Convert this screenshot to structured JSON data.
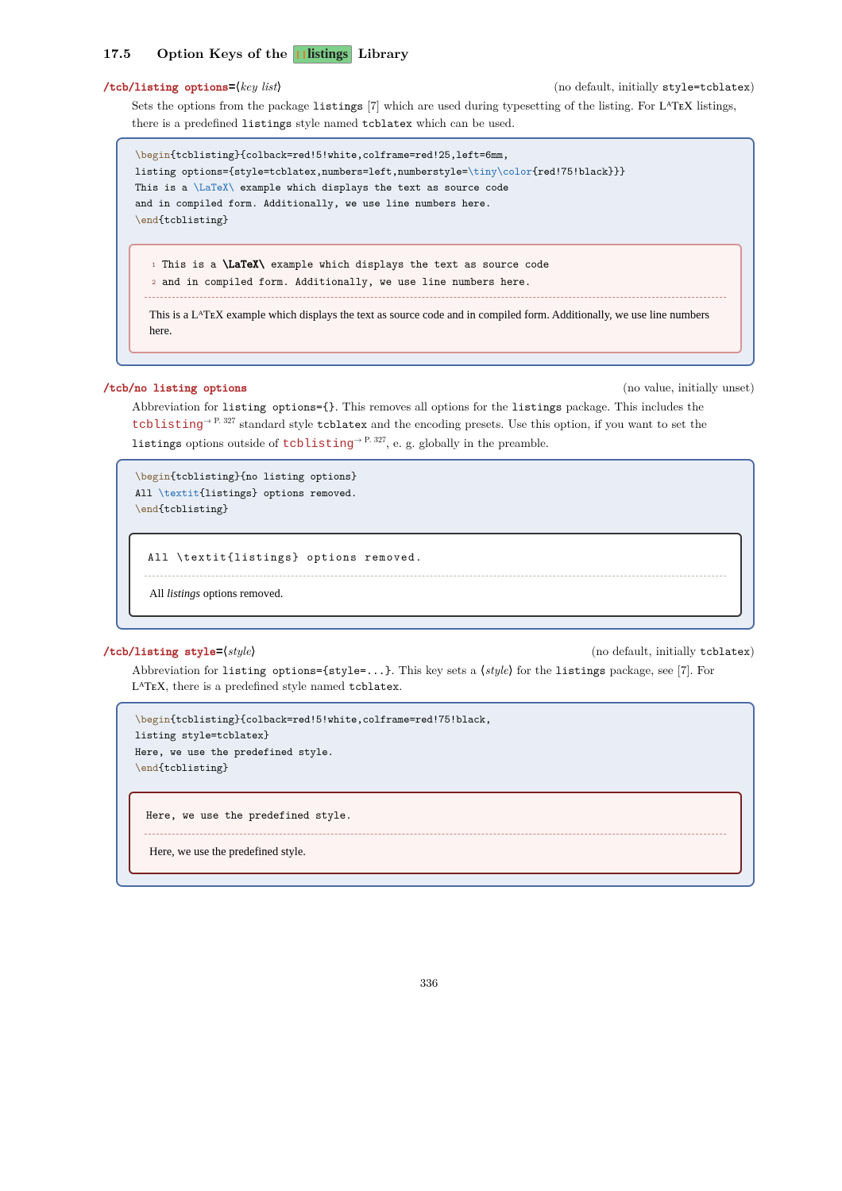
{
  "section_number": "17.5",
  "section_title_pre": "Option Keys of the ",
  "section_badge": "listings",
  "section_title_post": " Library",
  "key1": {
    "name": "/tcb/listing options",
    "arg": "key list",
    "meta_pre": "(no default, initially ",
    "meta_tt": "style=tcblatex",
    "meta_post": ")",
    "descr_1": "Sets the options from the package ",
    "descr_tt1": "listings",
    "descr_cite": " [7] which are used during typesetting of the listing. For ",
    "descr_latex": "LᴬTᴇX",
    "descr_2": " listings, there is a predefined ",
    "descr_tt2": "listings",
    "descr_3": " style named ",
    "descr_tt3": "tcblatex",
    "descr_4": " which can be used.",
    "code_l1a": "\\begin",
    "code_l1b": "{tcblisting}{colback=red!5!white,colframe=red!25,left=6mm,",
    "code_l2a": "listing options={style=tcblatex,numbers=left,numberstyle=",
    "code_l2b": "\\tiny\\color",
    "code_l2c": "{red!75!black}}}",
    "code_l3a": "This is a ",
    "code_l3b": "\\LaTeX\\",
    "code_l3c": " example which displays the text as source code",
    "code_l4": "and in compiled form. Additionally, we use line numbers here.",
    "code_l5a": "\\end",
    "code_l5b": "{tcblisting}",
    "num1": "1",
    "num2": "2",
    "listing_l1a": "This is a ",
    "listing_l1b": "\\LaTeX\\",
    "listing_l1c": " example which displays the text as source code",
    "listing_l2": "and in compiled form. Additionally, we use line numbers here.",
    "compiled_1a": "This is a ",
    "compiled_1b": "LᴬTᴇX",
    "compiled_1c": " example which displays the text as source code and in compiled form. Additionally, we use line numbers here."
  },
  "key2": {
    "name": "/tcb/no listing options",
    "meta": "(no value, initially unset)",
    "descr_a": "Abbreviation for ",
    "descr_tt1": "listing options={}",
    "descr_b": ". This removes all options for the ",
    "descr_tt2": "listings",
    "descr_c": " package. This includes the ",
    "descr_ref1": "tcblisting",
    "descr_pnote1": "→ P. 327",
    "descr_d": " standard style ",
    "descr_tt3": "tcblatex",
    "descr_e": " and the encoding presets. Use this option, if you want to set the ",
    "descr_tt4": "listings",
    "descr_f": " options outside of ",
    "descr_ref2": "tcblisting",
    "descr_pnote2": "→ P. 327",
    "descr_g": ", e. g. globally in the preamble.",
    "code_l1a": "\\begin",
    "code_l1b": "{tcblisting}{no listing options}",
    "code_l2a": "All ",
    "code_l2b": "\\textit",
    "code_l2c": "{listings} options removed.",
    "code_l3a": "\\end",
    "code_l3b": "{tcblisting}",
    "listing": "All \\textit{listings} options removed.",
    "compiled_a": "All ",
    "compiled_it": "listings",
    "compiled_b": " options removed."
  },
  "key3": {
    "name": "/tcb/listing style",
    "arg": "style",
    "meta_pre": "(no default, initially ",
    "meta_tt": "tcblatex",
    "meta_post": ")",
    "descr_a": "Abbreviation for ",
    "descr_tt1": "listing options={style=...}",
    "descr_b": ". This key sets a ⟨",
    "descr_it": "style",
    "descr_c": "⟩ for the ",
    "descr_tt2": "listings",
    "descr_d": " package, see [7]. For ",
    "descr_latex": "LᴬTᴇX",
    "descr_e": ", there is a predefined style named ",
    "descr_tt3": "tcblatex",
    "descr_f": ".",
    "code_l1a": "\\begin",
    "code_l1b": "{tcblisting}{colback=red!5!white,colframe=red!75!black,",
    "code_l2": "listing style=tcblatex}",
    "code_l3": "Here, we use the predefined style.",
    "code_l4a": "\\end",
    "code_l4b": "{tcblisting}",
    "listing": "Here, we use the predefined style.",
    "compiled": "Here, we use the predefined style."
  },
  "page_number": "336"
}
